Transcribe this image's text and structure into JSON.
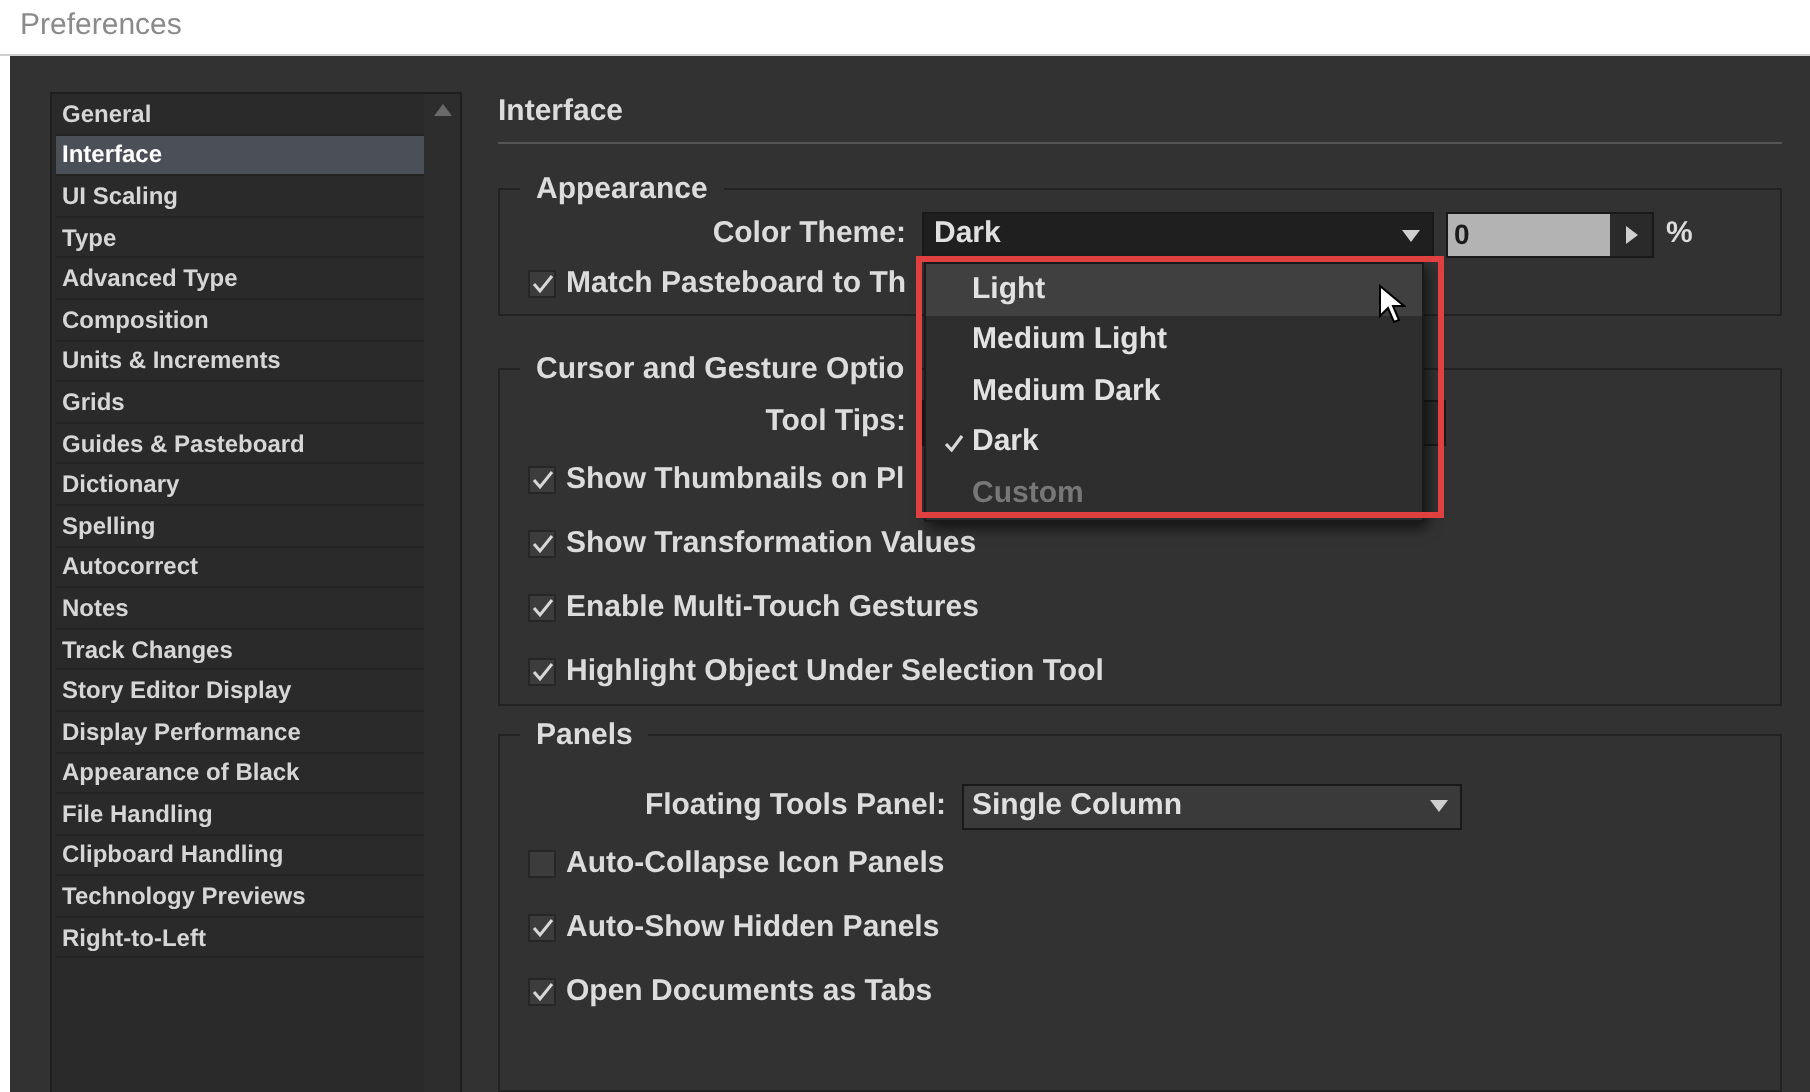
{
  "window": {
    "title": "Preferences"
  },
  "sidebar": {
    "items": [
      {
        "label": "General",
        "selected": false
      },
      {
        "label": "Interface",
        "selected": true
      },
      {
        "label": "UI Scaling",
        "selected": false
      },
      {
        "label": "Type",
        "selected": false
      },
      {
        "label": "Advanced Type",
        "selected": false
      },
      {
        "label": "Composition",
        "selected": false
      },
      {
        "label": "Units & Increments",
        "selected": false
      },
      {
        "label": "Grids",
        "selected": false
      },
      {
        "label": "Guides & Pasteboard",
        "selected": false
      },
      {
        "label": "Dictionary",
        "selected": false
      },
      {
        "label": "Spelling",
        "selected": false
      },
      {
        "label": "Autocorrect",
        "selected": false
      },
      {
        "label": "Notes",
        "selected": false
      },
      {
        "label": "Track Changes",
        "selected": false
      },
      {
        "label": "Story Editor Display",
        "selected": false
      },
      {
        "label": "Display Performance",
        "selected": false
      },
      {
        "label": "Appearance of Black",
        "selected": false
      },
      {
        "label": "File Handling",
        "selected": false
      },
      {
        "label": "Clipboard Handling",
        "selected": false
      },
      {
        "label": "Technology Previews",
        "selected": false
      },
      {
        "label": "Right-to-Left",
        "selected": false
      }
    ]
  },
  "section_title": "Interface",
  "appearance": {
    "title": "Appearance",
    "color_theme": {
      "label": "Color Theme:",
      "value": "Dark",
      "menu": [
        {
          "label": "Light",
          "selected": false,
          "hovered": true,
          "disabled": false
        },
        {
          "label": "Medium Light",
          "selected": false,
          "hovered": false,
          "disabled": false
        },
        {
          "label": "Medium Dark",
          "selected": false,
          "hovered": false,
          "disabled": false
        },
        {
          "label": "Dark",
          "selected": true,
          "hovered": false,
          "disabled": false
        },
        {
          "label": "Custom",
          "selected": false,
          "hovered": false,
          "disabled": true
        }
      ]
    },
    "brightness": {
      "value": "0",
      "unit": "%"
    },
    "match_pasteboard": {
      "label": "Match Pasteboard to Th",
      "checked": true
    }
  },
  "cursor": {
    "title": "Cursor and Gesture Optio",
    "tool_tips": {
      "label": "Tool Tips:"
    },
    "checkboxes": [
      {
        "label": "Show Thumbnails on Pl",
        "checked": true
      },
      {
        "label": "Show Transformation Values",
        "checked": true
      },
      {
        "label": "Enable Multi-Touch Gestures",
        "checked": true
      },
      {
        "label": "Highlight Object Under Selection Tool",
        "checked": true
      }
    ]
  },
  "panels": {
    "title": "Panels",
    "floating_tools": {
      "label": "Floating Tools Panel:",
      "value": "Single Column"
    },
    "checkboxes": [
      {
        "label": "Auto-Collapse Icon Panels",
        "checked": false
      },
      {
        "label": "Auto-Show Hidden Panels",
        "checked": true
      },
      {
        "label": "Open Documents as Tabs",
        "checked": true
      }
    ]
  }
}
